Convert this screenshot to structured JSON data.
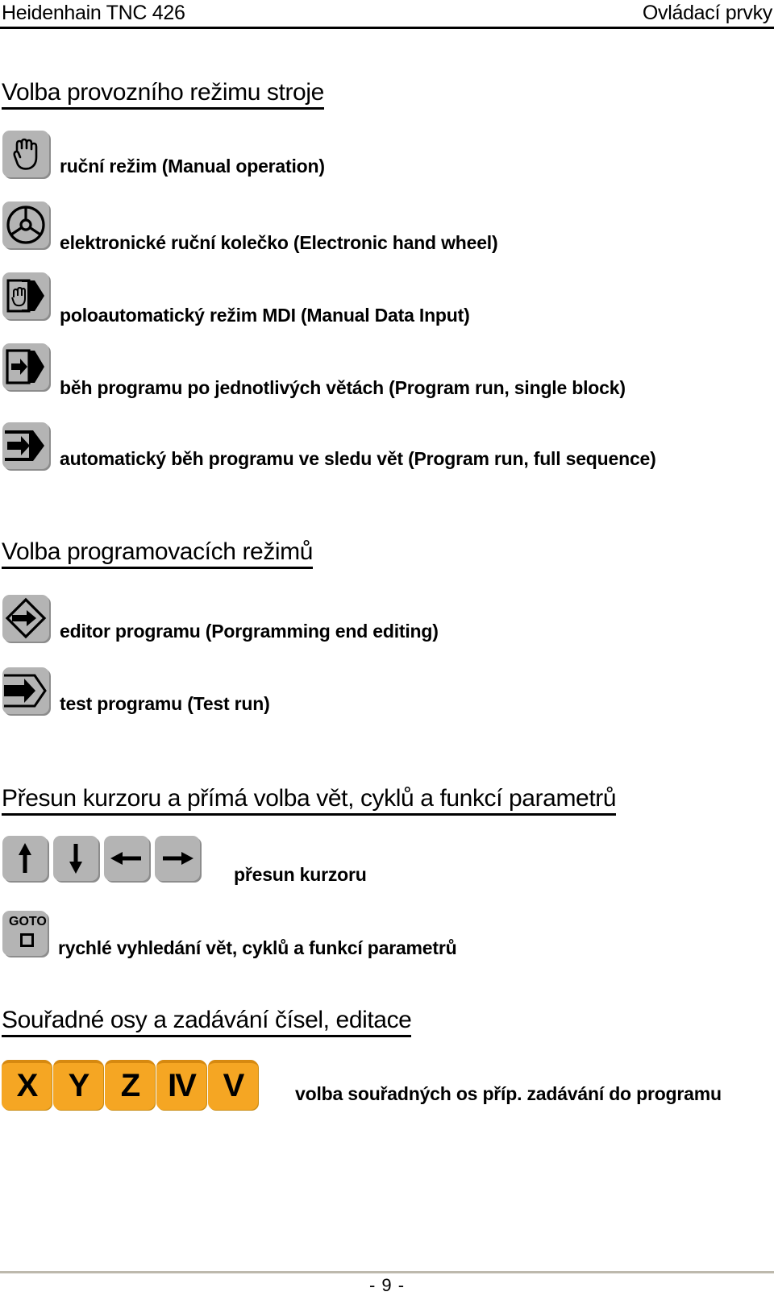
{
  "header": {
    "left_title": "Heidenhain TNC 426",
    "right_title": "Ovládací prvky"
  },
  "sections": [
    {
      "heading": "Volba provozního režimu stroje",
      "rows": [
        {
          "icon": "hand-icon",
          "caption": "ruční režim (Manual operation)"
        },
        {
          "icon": "handwheel-icon",
          "caption": "elektronické ruční kolečko (Electronic hand wheel)"
        },
        {
          "icon": "mdi-hand-arrow-icon",
          "caption": "poloautomatický režim MDI (Manual Data Input)"
        },
        {
          "icon": "single-block-arrow-icon",
          "caption": "běh programu po jednotlivých větách (Program run, single block)"
        },
        {
          "icon": "full-sequence-arrow-icon",
          "caption": "automatický běh programu ve sledu vět (Program run, full sequence)"
        }
      ]
    },
    {
      "heading": "Volba programovacích režimů",
      "rows": [
        {
          "icon": "diamond-arrow-icon",
          "caption": "editor programu (Porgramming end editing)"
        },
        {
          "icon": "test-run-arrow-icon",
          "caption": "test programu (Test run)"
        }
      ]
    },
    {
      "heading": "Přesun kurzoru a přímá volba vět, cyklů a funkcí parametrů",
      "rows": [
        {
          "icon": "cursor-arrow-keys",
          "caption": "přesun kurzoru"
        },
        {
          "icon": "goto-key-icon",
          "caption": "rychlé vyhledání vět, cyklů a funkcí parametrů"
        }
      ]
    },
    {
      "heading": "Souřadné osy a zadávání čísel, editace",
      "rows": [
        {
          "icon": "axis-keys",
          "caption": "volba souřadných os příp. zadávání do programu"
        }
      ]
    }
  ],
  "cursor_keys": [
    {
      "name": "arrow-up-key",
      "glyph": "up"
    },
    {
      "name": "arrow-down-key",
      "glyph": "down"
    },
    {
      "name": "arrow-left-key",
      "glyph": "left"
    },
    {
      "name": "arrow-right-key",
      "glyph": "right"
    }
  ],
  "goto_key": {
    "label": "GOTO"
  },
  "axis_keys": [
    {
      "label": "X"
    },
    {
      "label": "Y"
    },
    {
      "label": "Z"
    },
    {
      "label": "IV"
    },
    {
      "label": "V"
    }
  ],
  "footer": {
    "page_number": "- 9 -"
  },
  "colors": {
    "key_gray": "#b4b4b4",
    "key_shadow": "#8c8c8c",
    "axis_orange": "#f5a623",
    "axis_orange_top": "#d68910",
    "rule_black": "#000000",
    "footer_rule": "#bdb9ad"
  }
}
